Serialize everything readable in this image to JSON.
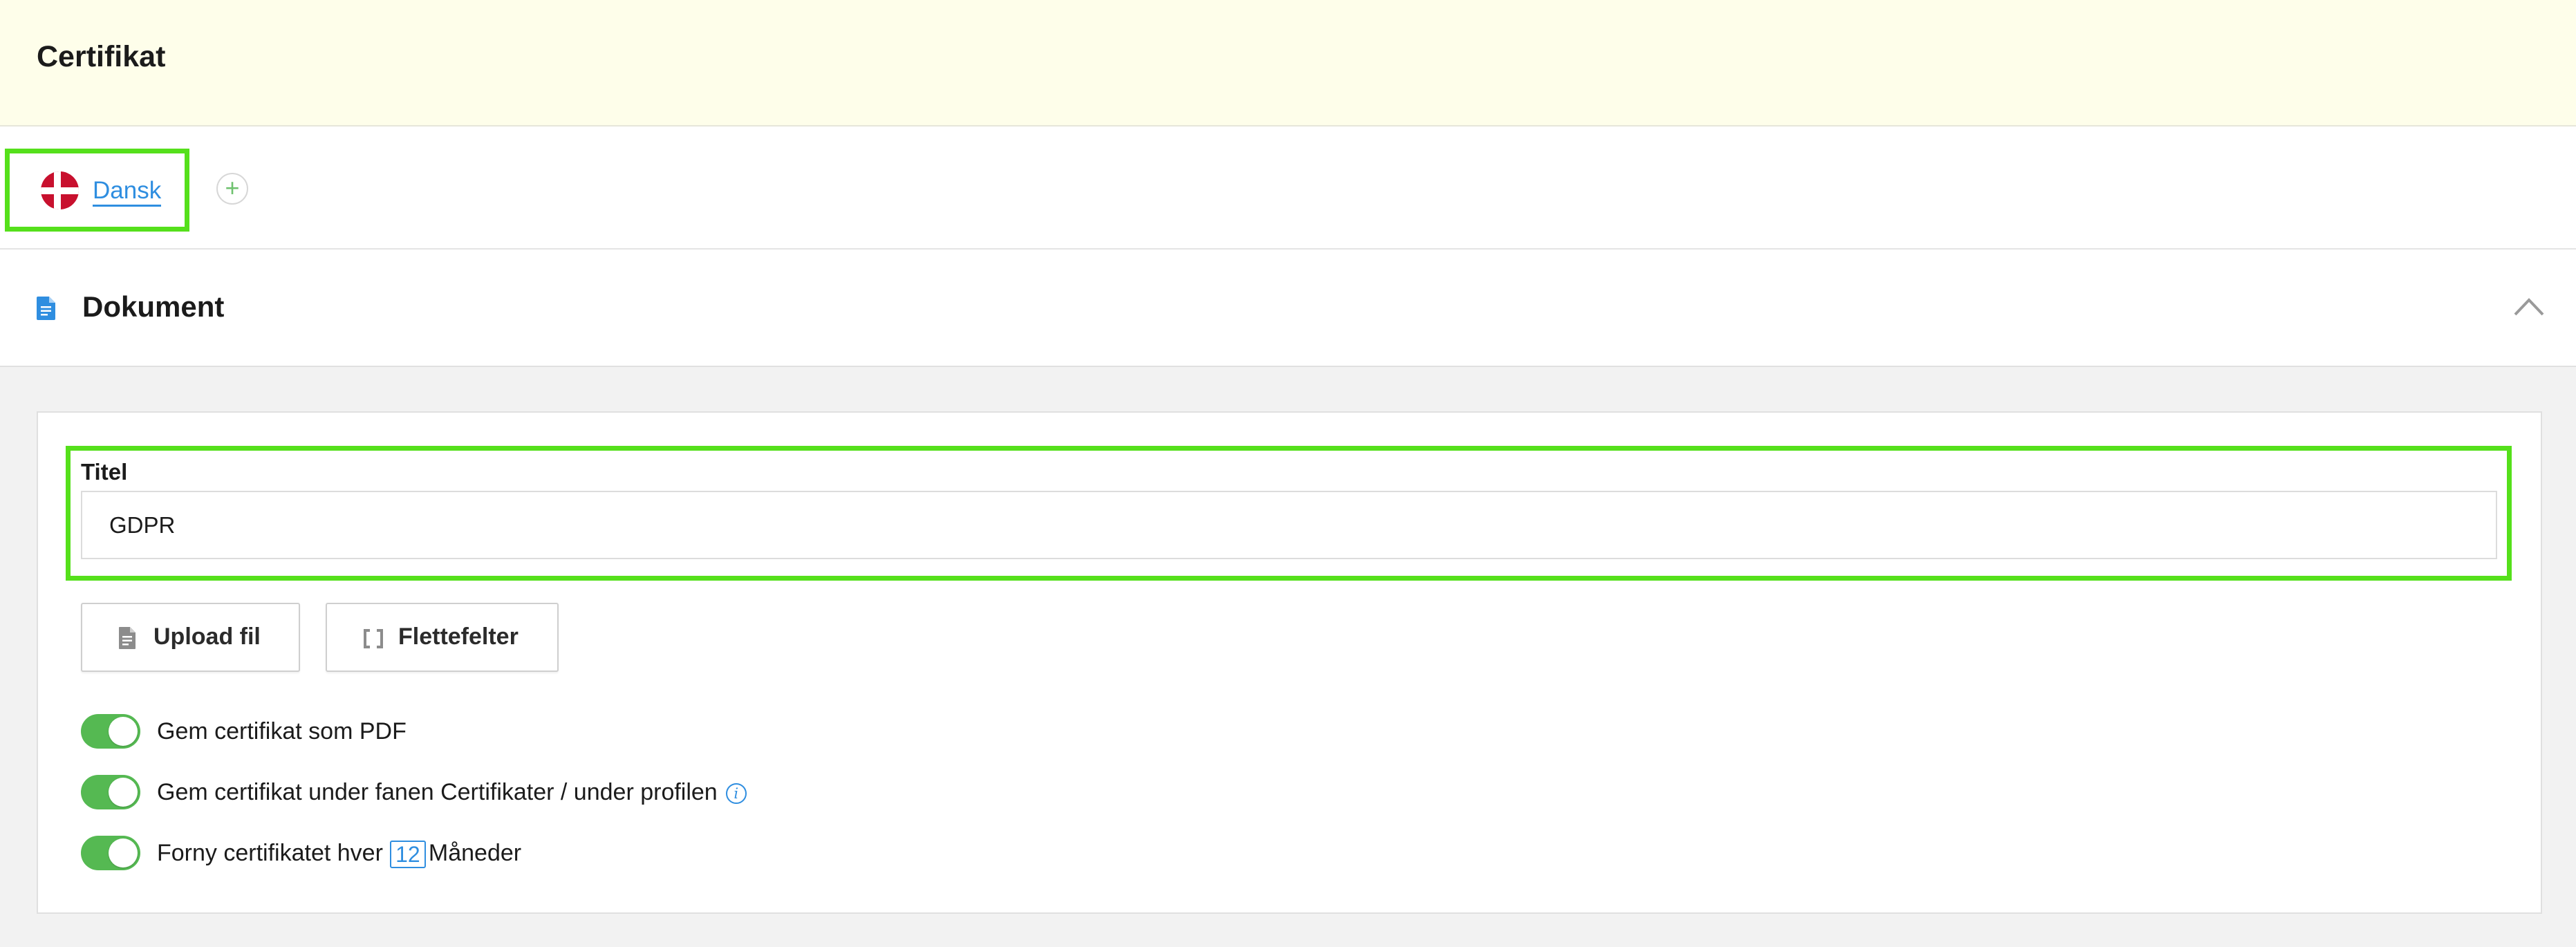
{
  "header": {
    "title": "Certifikat"
  },
  "languages": {
    "active": "Dansk",
    "add_symbol": "+"
  },
  "section": {
    "title": "Dokument"
  },
  "title_field": {
    "label": "Titel",
    "value": "GDPR"
  },
  "buttons": {
    "upload": "Upload fil",
    "merge_fields": "Flettefelter"
  },
  "toggles": [
    {
      "label": "Gem certifikat som PDF",
      "on": true
    },
    {
      "label": "Gem certifikat under fanen Certifikater / under profilen",
      "on": true
    },
    {
      "label_before": "Forny certifikatet hver",
      "months": "12",
      "label_after": "Måneder",
      "on": true
    }
  ],
  "info_symbol": "i",
  "colors": {
    "accent": "#2f8ee0",
    "toggle_on": "#55b952",
    "header_bg": "#fefeea",
    "highlight": "#55e01b"
  }
}
